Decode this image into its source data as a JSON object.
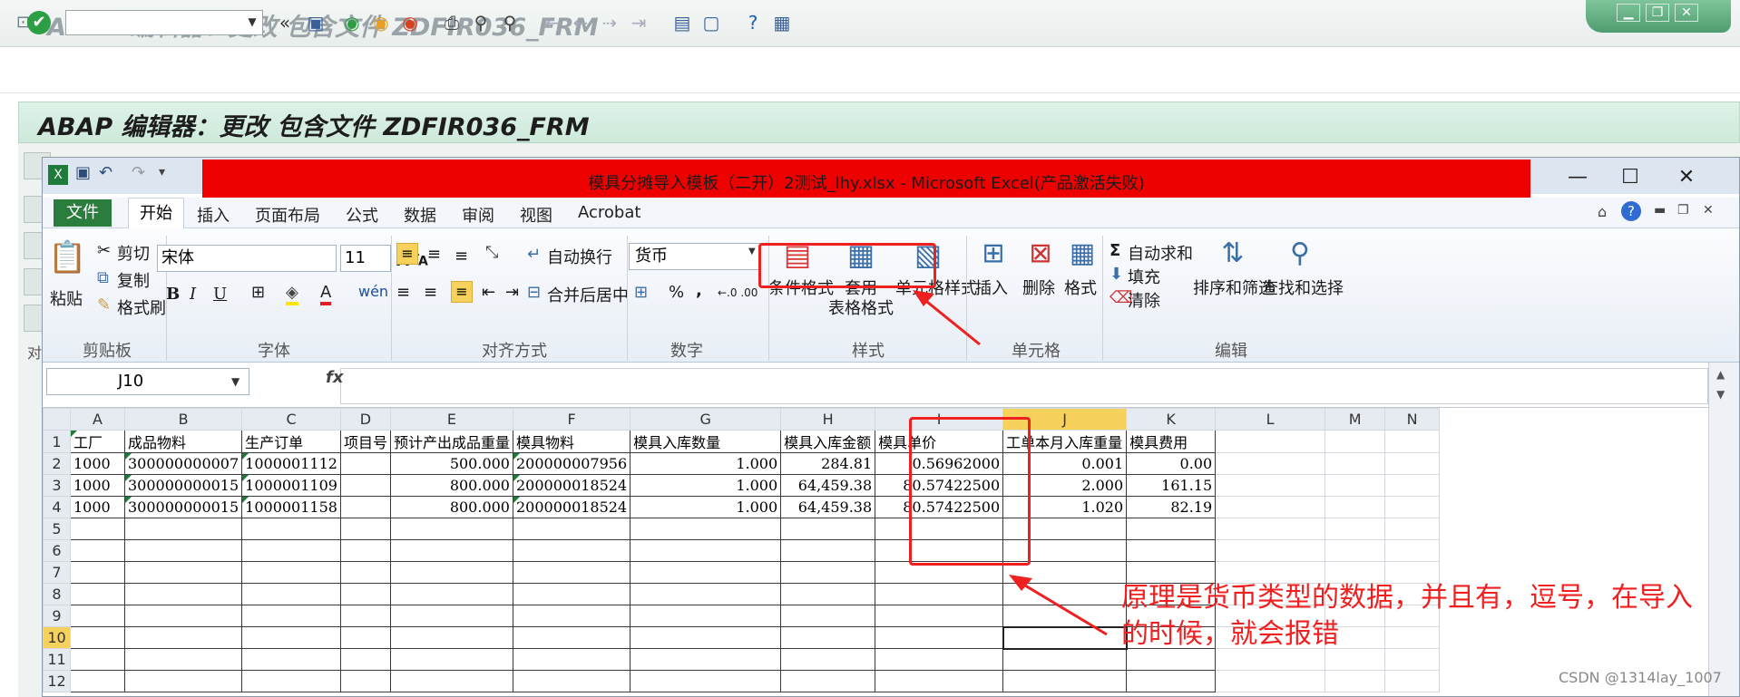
{
  "sap": {
    "title": "ABAP 编辑器：更改 包含文件 ZDFIR036_FRM",
    "header_title": "ABAP 编辑器：更改 包含文件 ZDFIR036_FRM",
    "command_field_value": "",
    "side_label": "对"
  },
  "excel": {
    "title": "模具分摊导入模板（二开）2测试_lhy.xlsx  -  Microsoft Excel(产品激活失败)",
    "menu": {
      "file": "文件",
      "home": "开始",
      "insert": "插入",
      "page_layout": "页面布局",
      "formulas": "公式",
      "data": "数据",
      "review": "审阅",
      "view": "视图",
      "acrobat": "Acrobat"
    },
    "ribbon": {
      "clipboard": {
        "label": "剪贴板",
        "paste": "粘贴",
        "cut": "剪切",
        "copy": "复制",
        "format_painter": "格式刷"
      },
      "font": {
        "label": "字体",
        "name": "宋体",
        "size": "11",
        "bold": "B",
        "italic": "I",
        "underline": "U",
        "wen": "wén"
      },
      "alignment": {
        "label": "对齐方式",
        "wrap_text": "自动换行",
        "merge_center": "合并后居中"
      },
      "number": {
        "label": "数字",
        "format": "货币",
        "percent": "%",
        "comma": ",",
        "inc_decimal": "←.0 .00",
        "dec_decimal": ".00 →.0"
      },
      "styles": {
        "label": "样式",
        "conditional": "条件格式",
        "table_format": "套用\n表格格式",
        "table_format_1": "套用",
        "table_format_2": "表格格式",
        "cell_styles": "单元格样式"
      },
      "cells": {
        "label": "单元格",
        "insert": "插入",
        "delete": "删除",
        "format": "格式"
      },
      "editing": {
        "label": "编辑",
        "autosum": "自动求和",
        "fill": "填充",
        "clear": "清除",
        "sort_filter": "排序和筛选",
        "find_select": "查找和选择"
      }
    },
    "name_box": "J10",
    "fx": "fx",
    "columns": [
      "A",
      "B",
      "C",
      "D",
      "E",
      "F",
      "G",
      "H",
      "I",
      "J",
      "K",
      "L",
      "M",
      "N"
    ],
    "row_numbers": [
      "1",
      "2",
      "3",
      "4",
      "5",
      "6",
      "7",
      "8",
      "9",
      "10",
      "11",
      "12"
    ],
    "rows": [
      [
        "工厂",
        "成品物料",
        "生产订单",
        "项目号",
        "预计产出成品重量",
        "模具物料",
        "模具入库数量",
        "模具入库金额",
        "模具单价",
        "工单本月入库重量",
        "模具费用",
        "",
        "",
        ""
      ],
      [
        "1000",
        "300000000007",
        "1000001112",
        "",
        "500.000",
        "200000007956",
        "1.000",
        "284.81",
        "0.56962000",
        "0.001",
        "0.00",
        "",
        "",
        ""
      ],
      [
        "1000",
        "300000000015",
        "1000001109",
        "",
        "800.000",
        "200000018524",
        "1.000",
        "64,459.38",
        "80.57422500",
        "2.000",
        "161.15",
        "",
        "",
        ""
      ],
      [
        "1000",
        "300000000015",
        "1000001158",
        "",
        "800.000",
        "200000018524",
        "1.000",
        "64,459.38",
        "80.57422500",
        "1.020",
        "82.19",
        "",
        "",
        ""
      ]
    ]
  },
  "annotation": {
    "text": "原理是货币类型的数据，并且有，逗号，在导入的时候，就会报错",
    "color": "#f02020"
  },
  "watermark": "CSDN @1314lay_1007",
  "colors": {
    "excel_green": "#2a7d3c",
    "highlight_red": "#ee0000",
    "selected_header": "#f6d25d"
  }
}
